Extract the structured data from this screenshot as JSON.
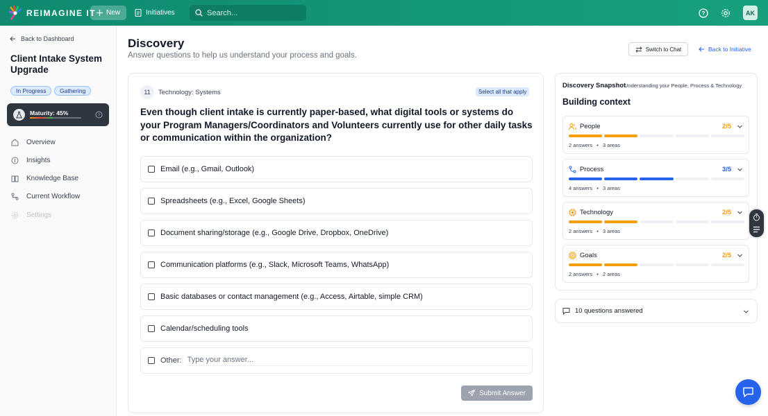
{
  "app": {
    "brand": "REIMAGINE IT",
    "new_label": "New",
    "initiatives_label": "Initiatives",
    "search_placeholder": "Search...",
    "avatar_initials": "AK"
  },
  "sidebar": {
    "back_label": "Back to Dashboard",
    "project_title": "Client Intake System Upgrade",
    "badges": [
      "In Progress",
      "Gathering"
    ],
    "maturity_label": "Maturity: 45%",
    "maturity_value": 0.45,
    "items": [
      {
        "label": "Overview",
        "icon": "home-icon",
        "enabled": true
      },
      {
        "label": "Insights",
        "icon": "lightbulb-icon",
        "enabled": true
      },
      {
        "label": "Knowledge Base",
        "icon": "book-icon",
        "enabled": true
      },
      {
        "label": "Current Workflow",
        "icon": "workflow-icon",
        "enabled": true
      },
      {
        "label": "Settings",
        "icon": "gear-icon",
        "enabled": false
      }
    ]
  },
  "header": {
    "title": "Discovery",
    "subtitle": "Answer questions to help us understand your process and goals.",
    "switch_chat": "Switch to Chat",
    "back_initiative": "Back to Initiative"
  },
  "question": {
    "number": "11",
    "category": "Technology: Systems",
    "hint": "Select all that apply",
    "text": "Even though client intake is currently paper-based, what digital tools or systems do your Program Managers/Coordinators and Volunteers currently use for other daily tasks or communication within the organization?",
    "options": [
      "Email (e.g., Gmail, Outlook)",
      "Spreadsheets (e.g., Excel, Google Sheets)",
      "Document sharing/storage (e.g., Google Drive, Dropbox, OneDrive)",
      "Communication platforms (e.g., Slack, Microsoft Teams, WhatsApp)",
      "Basic databases or contact management (e.g., Access, Airtable, simple CRM)",
      "Calendar/scheduling tools"
    ],
    "other_label": "Other:",
    "other_placeholder": "Type your answer...",
    "submit_label": "Submit Answer"
  },
  "snapshot": {
    "title": "Discovery Snapshot",
    "subtitle": "Understanding your People, Process & Technology",
    "heading": "Building context",
    "areas": [
      {
        "name": "People",
        "score": "2/5",
        "filled": 2,
        "color": "#f59e0b",
        "answers": "2 answers",
        "areas": "3 areas"
      },
      {
        "name": "Process",
        "score": "3/5",
        "filled": 3,
        "color": "#2563eb",
        "answers": "4 answers",
        "areas": "3 areas"
      },
      {
        "name": "Technology",
        "score": "2/5",
        "filled": 2,
        "color": "#f59e0b",
        "answers": "2 answers",
        "areas": "3 areas"
      },
      {
        "name": "Goals",
        "score": "2/5",
        "filled": 2,
        "color": "#f59e0b",
        "answers": "2 answers",
        "areas": "2 areas"
      }
    ],
    "bullet": "•",
    "answered": "10 questions answered"
  }
}
